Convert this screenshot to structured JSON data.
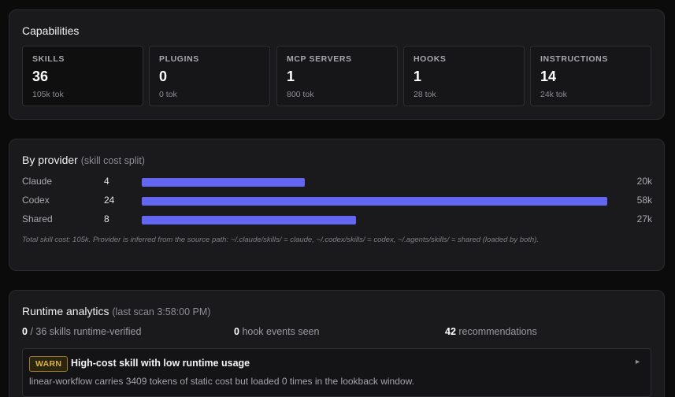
{
  "capabilities": {
    "title": "Capabilities",
    "cards": [
      {
        "label": "SKILLS",
        "value": "36",
        "sub": "105k tok"
      },
      {
        "label": "PLUGINS",
        "value": "0",
        "sub": "0 tok"
      },
      {
        "label": "MCP SERVERS",
        "value": "1",
        "sub": "800 tok"
      },
      {
        "label": "HOOKS",
        "value": "1",
        "sub": "28 tok"
      },
      {
        "label": "INSTRUCTIONS",
        "value": "14",
        "sub": "24k tok"
      }
    ]
  },
  "provider": {
    "title": "By provider",
    "subtitle": "(skill cost split)",
    "rows": [
      {
        "name": "Claude",
        "count": "4",
        "tokens": "20k",
        "share": 0.35
      },
      {
        "name": "Codex",
        "count": "24",
        "tokens": "58k",
        "share": 1.0
      },
      {
        "name": "Shared",
        "count": "8",
        "tokens": "27k",
        "share": 0.46
      }
    ],
    "note": "Total skill cost: 105k. Provider is inferred from the source path: ~/.claude/skills/ = claude, ~/.codex/skills/ = codex, ~/.agents/skills/ = shared (loaded by both).",
    "bar_color": "#6366f1"
  },
  "runtime": {
    "title": "Runtime analytics",
    "subtitle": "(last scan 3:58:00 PM)",
    "stats": [
      {
        "value": "0",
        "text": "/ 36 skills runtime-verified"
      },
      {
        "value": "0",
        "text": "hook events seen"
      },
      {
        "value": "42",
        "text": "recommendations"
      }
    ],
    "recommendation": {
      "badge": "WARN",
      "title": "High-cost skill with low runtime usage",
      "description": "linear-workflow carries 3409 tokens of static cost but loaded 0 times in the lookback window.",
      "caret": "►"
    }
  }
}
